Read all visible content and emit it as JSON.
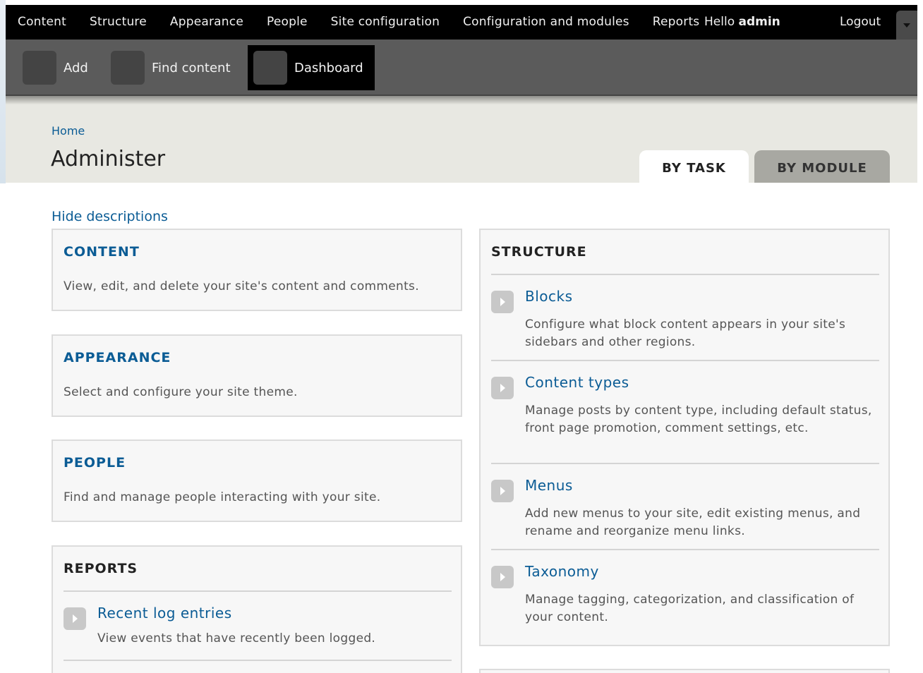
{
  "toolbar": {
    "menu": [
      "Content",
      "Structure",
      "Appearance",
      "People",
      "Site configuration",
      "Configuration and modules",
      "Reports"
    ],
    "user_greeting": "Hello ",
    "user_name": "admin",
    "logout": "Logout"
  },
  "shortcuts": [
    {
      "label": "Add"
    },
    {
      "label": "Find content"
    },
    {
      "label": "Dashboard"
    }
  ],
  "breadcrumb": "Home",
  "page_title": "Administer",
  "tabs": {
    "active": "BY TASK",
    "inactive": "BY MODULE"
  },
  "hide_descriptions": "Hide descriptions",
  "panels": {
    "content": {
      "title": "CONTENT",
      "desc": "View, edit, and delete your site's content and comments."
    },
    "appearance": {
      "title": "APPEARANCE",
      "desc": "Select and configure your site theme."
    },
    "people": {
      "title": "PEOPLE",
      "desc": "Find and manage people interacting with your site."
    },
    "reports": {
      "title": "REPORTS",
      "items": [
        {
          "link": "Recent log entries",
          "desc": "View events that have recently been logged."
        }
      ]
    },
    "structure": {
      "title": "STRUCTURE",
      "items": [
        {
          "link": "Blocks",
          "desc": "Configure what block content appears in your site's sidebars and other regions."
        },
        {
          "link": "Content types",
          "desc": "Manage posts by content type, including default status, front page promotion, comment settings, etc."
        },
        {
          "link": "Menus",
          "desc": "Add new menus to your site, edit existing menus, and rename and reorganize menu links."
        },
        {
          "link": "Taxonomy",
          "desc": "Manage tagging, categorization, and classification of your content."
        }
      ]
    }
  },
  "colors": {
    "link": "#0b5c95",
    "toolbar": "#000000",
    "shortcuts": "#5b5b5b",
    "header_bg": "#e8e8e2"
  }
}
